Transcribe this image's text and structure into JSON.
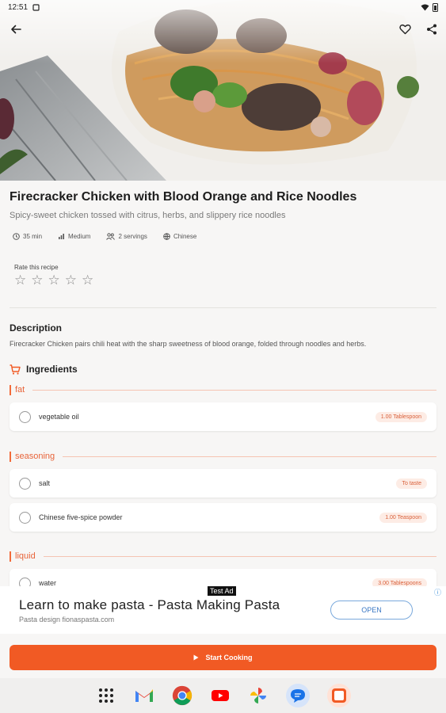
{
  "status": {
    "time": "12:51"
  },
  "recipe": {
    "title": "Firecracker Chicken with Blood Orange and Rice Noodles",
    "subtitle": "Spicy-sweet chicken tossed with citrus, herbs, and slippery rice noodles",
    "meta": {
      "time": "35 min",
      "difficulty": "Medium",
      "servings": "2 servings",
      "cuisine": "Chinese"
    }
  },
  "rating": {
    "label": "Rate this recipe",
    "stars": [
      "☆",
      "☆",
      "☆",
      "☆",
      "☆"
    ]
  },
  "description": {
    "heading": "Description",
    "text": "Firecracker Chicken pairs chili heat with the sharp sweetness of blood orange, folded through noodles and herbs."
  },
  "ingredients": {
    "heading": "Ingredients",
    "sections": [
      {
        "name": "fat",
        "items": [
          {
            "name": "vegetable oil",
            "qty": "1.00 Tablespoon"
          }
        ]
      },
      {
        "name": "seasoning",
        "items": [
          {
            "name": "salt",
            "qty": "To taste"
          },
          {
            "name": "Chinese five-spice powder",
            "qty": "1.00 Teaspoon"
          }
        ]
      },
      {
        "name": "liquid",
        "items": [
          {
            "name": "water",
            "qty": "3.00 Tablespoons"
          }
        ]
      }
    ]
  },
  "ad": {
    "tag": "Test Ad",
    "title": "Learn to make pasta - Pasta Making Pasta",
    "subtitle": "Pasta design fionaspasta.com",
    "cta": "OPEN"
  },
  "start_button": {
    "label": "Start Cooking"
  },
  "colors": {
    "accent": "#f15a24",
    "section_label": "#e8643a"
  },
  "dock": [
    "apps-grid-icon",
    "gmail-icon",
    "chrome-icon",
    "youtube-icon",
    "photos-icon",
    "messages-icon",
    "app-icon"
  ]
}
